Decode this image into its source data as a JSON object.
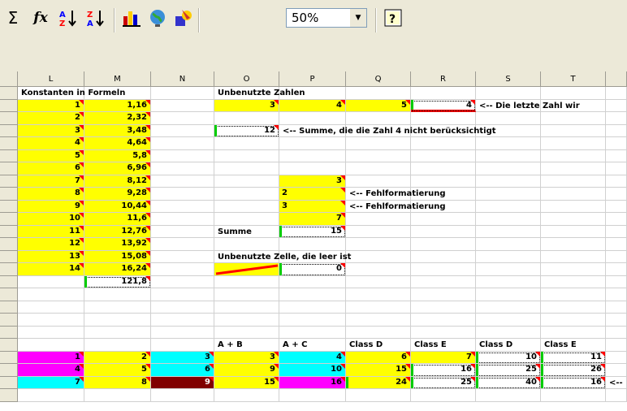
{
  "toolbar": {
    "sum_label": "Σ",
    "fx_label": "fx",
    "zoom_value": "50%"
  },
  "columns": [
    "L",
    "M",
    "N",
    "O",
    "P",
    "Q",
    "R",
    "S",
    "T"
  ],
  "headers": {
    "konstanten": "Konstanten in Formeln",
    "unbenutzte": "Unbenutzte Zahlen",
    "letzte_zahl": "<-- Die letzte Zahl wir",
    "summe_note": "<-- Summe, die die Zahl 4 nicht berücksichtigt",
    "fehl1": "<-- Fehlformatierung",
    "fehl2": "<-- Fehlformatierung",
    "summe_label": "Summe",
    "leer_zelle": "Unbenutzte Zelle, die leer ist",
    "hdr_ab": "A + B",
    "hdr_ac": "A + C",
    "hdr_d1": "Class D",
    "hdr_e1": "Class E",
    "hdr_d2": "Class D",
    "hdr_e2": "Class E",
    "tail_arrow": "<--"
  },
  "L_values": [
    "1",
    "2",
    "3",
    "4",
    "5",
    "6",
    "7",
    "8",
    "9",
    "10",
    "11",
    "12",
    "13",
    "14"
  ],
  "M_values": [
    "1,16",
    "2,32",
    "3,48",
    "4,64",
    "5,8",
    "6,96",
    "8,12",
    "9,28",
    "10,44",
    "11,6",
    "12,76",
    "13,92",
    "15,08",
    "16,24"
  ],
  "M_total": "121,8",
  "unbenutzt": {
    "o": "3",
    "p": "4",
    "q": "5",
    "r": "4"
  },
  "summe_value": "12",
  "p_block": {
    "p1": "3",
    "p2": "2",
    "p3": "3",
    "p4": "7"
  },
  "summe2_value": "15",
  "leer_value": "0",
  "bottom_rows": [
    [
      "1",
      "2",
      "3",
      "3",
      "4",
      "6",
      "7",
      "10",
      "11"
    ],
    [
      "4",
      "5",
      "6",
      "9",
      "10",
      "15",
      "16",
      "25",
      "26"
    ],
    [
      "7",
      "8",
      "9",
      "15",
      "16",
      "24",
      "25",
      "40",
      "16"
    ]
  ]
}
